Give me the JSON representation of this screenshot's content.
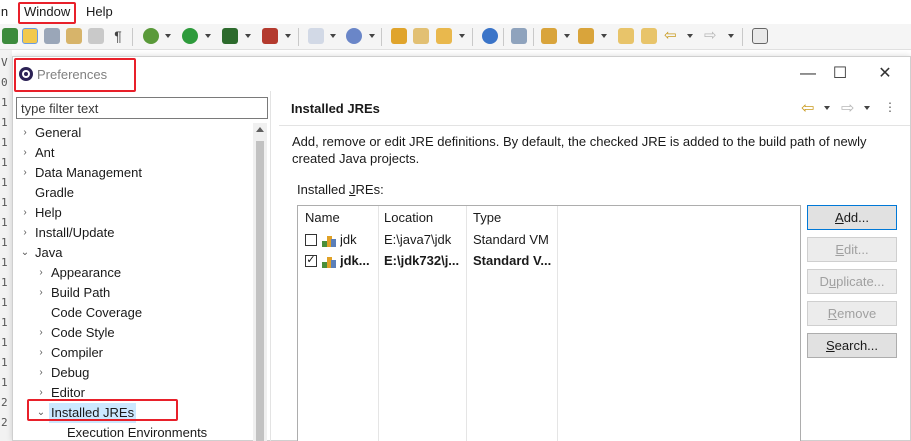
{
  "menubar": {
    "items": [
      "in",
      "Window",
      "Help"
    ]
  },
  "gutter_numbers": [
    "V",
    "0",
    "1",
    "1",
    "1",
    "1",
    "1",
    "1",
    "1",
    "1",
    "1",
    "1",
    "1",
    "1",
    "1",
    "1",
    "1",
    "2",
    "2"
  ],
  "dialog": {
    "title": "Preferences",
    "minimize": "—",
    "maximize": "☐",
    "close": "✕"
  },
  "filter": {
    "placeholder": "type filter text"
  },
  "tree": [
    {
      "label": "General",
      "arrow": "›",
      "level": 0
    },
    {
      "label": "Ant",
      "arrow": "›",
      "level": 0
    },
    {
      "label": "Data Management",
      "arrow": "›",
      "level": 0
    },
    {
      "label": "Gradle",
      "arrow": "",
      "level": 0
    },
    {
      "label": "Help",
      "arrow": "›",
      "level": 0
    },
    {
      "label": "Install/Update",
      "arrow": "›",
      "level": 0
    },
    {
      "label": "Java",
      "arrow": "⌄",
      "level": 0
    },
    {
      "label": "Appearance",
      "arrow": "›",
      "level": 1
    },
    {
      "label": "Build Path",
      "arrow": "›",
      "level": 1
    },
    {
      "label": "Code Coverage",
      "arrow": "",
      "level": 1
    },
    {
      "label": "Code Style",
      "arrow": "›",
      "level": 1
    },
    {
      "label": "Compiler",
      "arrow": "›",
      "level": 1
    },
    {
      "label": "Debug",
      "arrow": "›",
      "level": 1
    },
    {
      "label": "Editor",
      "arrow": "›",
      "level": 1
    },
    {
      "label": "Installed JREs",
      "arrow": "⌄",
      "level": 1,
      "selected": true
    },
    {
      "label": "Execution Environments",
      "arrow": "",
      "level": 2
    }
  ],
  "page": {
    "title": "Installed JREs",
    "description": "Add, remove or edit JRE definitions. By default, the checked JRE is added to the build path of newly created Java projects.",
    "jres_label_prefix": "Installed ",
    "jres_label_mnemonic": "J",
    "jres_label_suffix": "REs:",
    "nav_back": "⇦",
    "nav_forward": "⇨",
    "view_menu": "⋮"
  },
  "table": {
    "columns": [
      "Name",
      "Location",
      "Type"
    ],
    "rows": [
      {
        "checked": false,
        "name": "jdk",
        "location": "E:\\java7\\jdk",
        "type": "Standard VM",
        "bold": false
      },
      {
        "checked": true,
        "name": "jdk...",
        "location": "E:\\jdk732\\j...",
        "type": "Standard V...",
        "bold": true
      }
    ]
  },
  "buttons": {
    "add": {
      "pre": "",
      "u": "A",
      "post": "dd..."
    },
    "edit": {
      "pre": "",
      "u": "E",
      "post": "dit..."
    },
    "duplicate": {
      "pre": "D",
      "u": "u",
      "post": "plicate..."
    },
    "remove": {
      "pre": "",
      "u": "R",
      "post": "emove"
    },
    "search": {
      "pre": "",
      "u": "S",
      "post": "earch..."
    }
  },
  "colors": {
    "annotation_red": "#e8202a",
    "selection_bg": "#cce8ff",
    "default_button_border": "#0078d7"
  }
}
